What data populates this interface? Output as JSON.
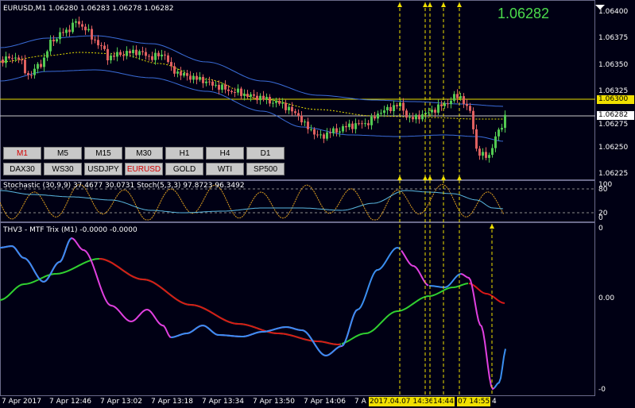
{
  "symbol_header": "EURUSD,M1  1.06280 1.06283 1.06278 1.06282",
  "current_price_big": "1.06282",
  "price_axis": [
    "1.06400",
    "1.06375",
    "1.06350",
    "1.06325",
    "1.06300",
    "1.06282",
    "1.06275",
    "1.06250",
    "1.06225"
  ],
  "stoch_header": "Stochastic (30,9,9) 37.4677 30.0731  Stoch(5,3,3) 97.8723 96.3492",
  "stoch_axis": [
    "100",
    "80",
    "20",
    "0"
  ],
  "trix_header": "THV3 - MTF Trix (M1) -0.0000 -0.0000",
  "trix_axis": [
    "0",
    "0.00",
    "-0"
  ],
  "timeframe_buttons": [
    "M1",
    "M5",
    "M15",
    "M30",
    "H1",
    "H4",
    "D1"
  ],
  "symbol_buttons": [
    "DAX30",
    "WS30",
    "USDJPY",
    "EURUSD",
    "GOLD",
    "WTI",
    "SP500"
  ],
  "time_labels": [
    "7 Apr 2017",
    "7 Apr 12:46",
    "7 Apr 13:02",
    "7 Apr 13:18",
    "7 Apr 13:34",
    "7 Apr 13:50",
    "7 Apr 14:06",
    "7 A"
  ],
  "time_highlights": [
    "2017.04.07 14:36",
    "14:44",
    "07 14:55"
  ],
  "time_tail": "4",
  "colors": {
    "background": "#000014",
    "bull_candle": "#52c952",
    "bear_candle": "#e06060",
    "band": "#3a6cd8",
    "mid_band": "#e8e000",
    "price_line": "#e8e000",
    "trix_fast_up": "#3a8ef0",
    "trix_fast_down": "#e040e0",
    "trix_slow_up": "#30d030",
    "trix_slow_down": "#d81818",
    "stoch_main": "#e0a020",
    "stoch_signal": "#5ab8e0",
    "marker": "#f0e000"
  }
}
